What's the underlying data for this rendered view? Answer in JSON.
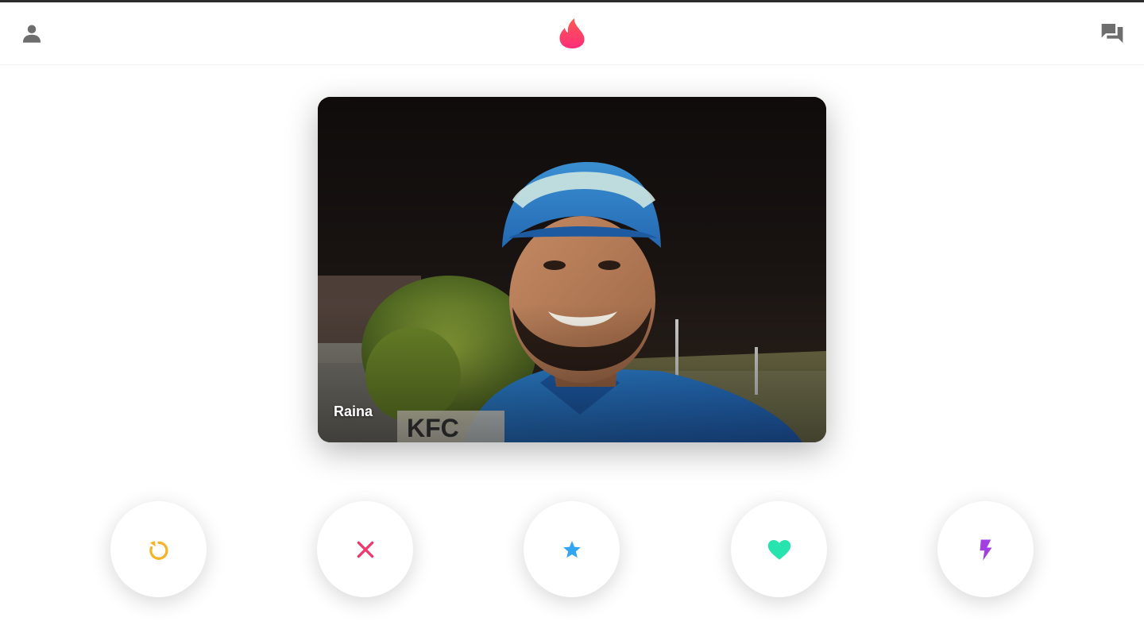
{
  "header": {
    "profile_icon": "person-icon",
    "logo_icon": "flame-logo-icon",
    "messages_icon": "chat-bubbles-icon",
    "brand_color": "#fd3a73"
  },
  "card": {
    "name": "Raina",
    "photo_description_icon": "profile-photo"
  },
  "actions": [
    {
      "id": "rewind",
      "icon": "rewind-icon",
      "color": "#f5b32b"
    },
    {
      "id": "nope",
      "icon": "close-icon",
      "color": "#f1396d"
    },
    {
      "id": "super-like",
      "icon": "star-icon",
      "color": "#31a6f5"
    },
    {
      "id": "like",
      "icon": "heart-icon",
      "color": "#27e3ad"
    },
    {
      "id": "boost",
      "icon": "lightning-icon",
      "color": "#a340e3"
    }
  ]
}
